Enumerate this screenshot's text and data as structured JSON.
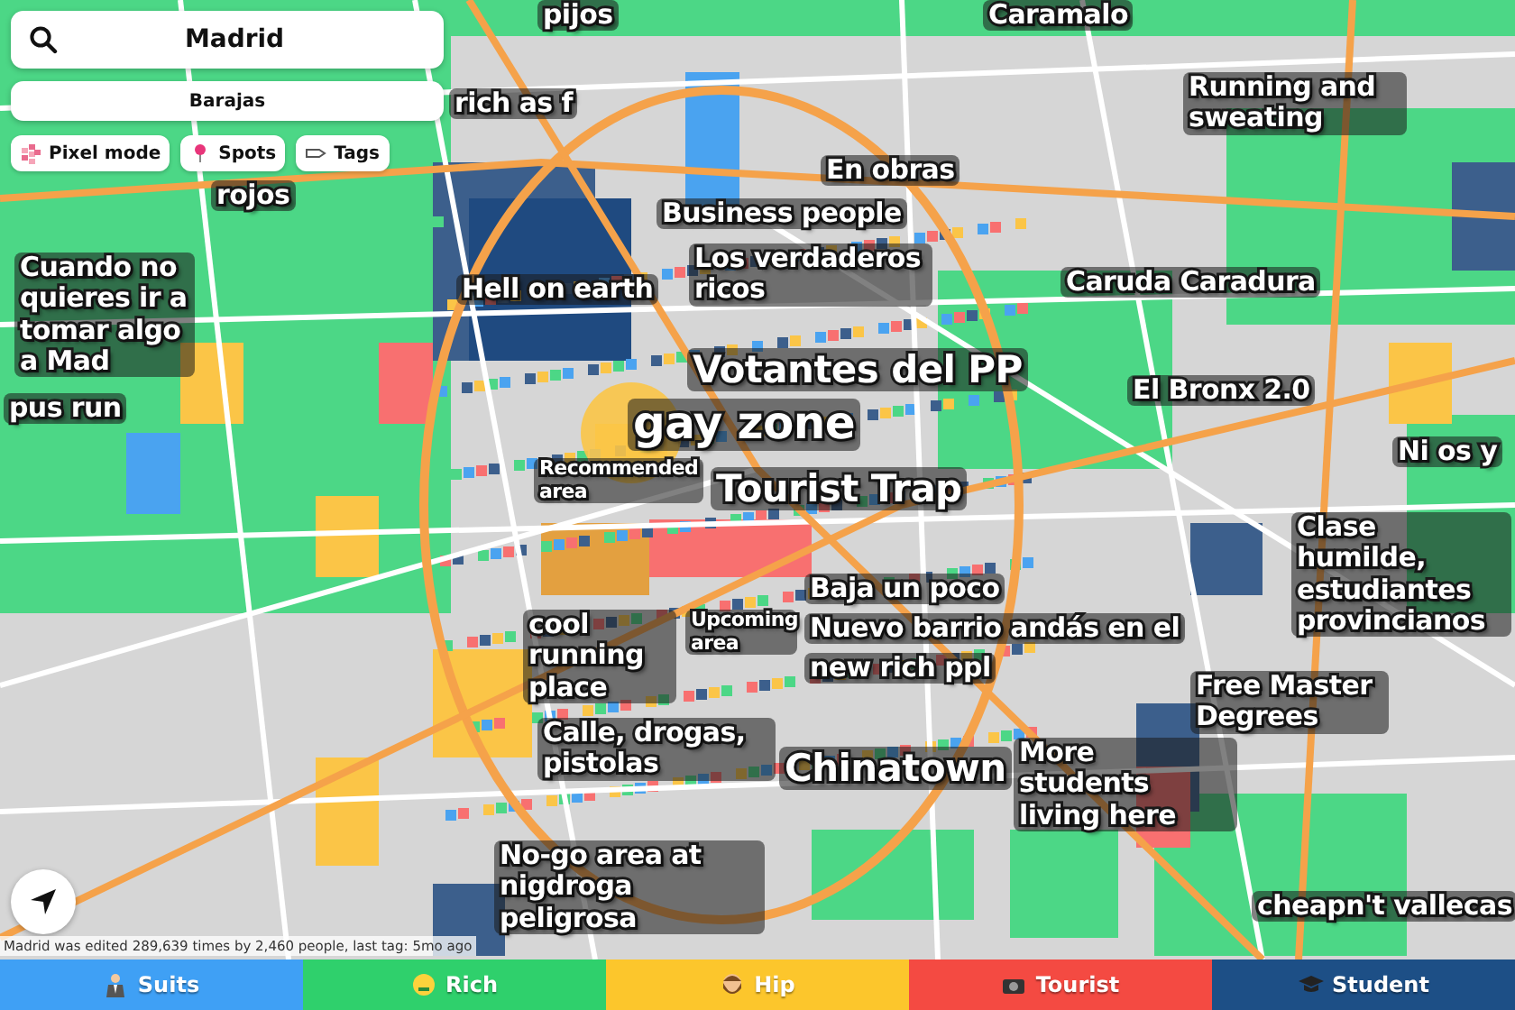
{
  "search": {
    "value": "Madrid"
  },
  "location": {
    "value": "Barajas"
  },
  "chips": [
    {
      "kind": "pixel",
      "label": "Pixel mode"
    },
    {
      "kind": "spots",
      "label": "Spots"
    },
    {
      "kind": "tags",
      "label": "Tags"
    }
  ],
  "map_tags": [
    {
      "text": "pijos"
    },
    {
      "text": "Caramalo"
    },
    {
      "text": "rich as f"
    },
    {
      "text": "Running and sweating"
    },
    {
      "text": "En obras"
    },
    {
      "text": "rojos"
    },
    {
      "text": "Business people"
    },
    {
      "text": "Cuando no quieres ir a tomar algo a Mad"
    },
    {
      "text": "Hell on earth"
    },
    {
      "text": "Los verdaderos ricos"
    },
    {
      "text": "Caruda Caradura"
    },
    {
      "text": "Votantes del PP"
    },
    {
      "text": "pus run"
    },
    {
      "text": "El Bronx 2.0"
    },
    {
      "text": "gay zone"
    },
    {
      "text": "Ni os y"
    },
    {
      "text": "Recommended area"
    },
    {
      "text": "Tourist Trap"
    },
    {
      "text": "Clase humilde, estudiantes provincianos"
    },
    {
      "text": "Baja un poco"
    },
    {
      "text": "cool running place"
    },
    {
      "text": "Upcoming area"
    },
    {
      "text": "Nuevo barrio andás en el"
    },
    {
      "text": "new rich ppl"
    },
    {
      "text": "Free Master Degrees"
    },
    {
      "text": "Calle, drogas, pistolas"
    },
    {
      "text": "Chinatown"
    },
    {
      "text": "More students living here"
    },
    {
      "text": "No-go area at nigdroga peligrosa"
    },
    {
      "text": "cheapn't vallecas"
    }
  ],
  "attribution": "Madrid was edited 289,639 times by 2,460 people, last tag: 5mo ago",
  "categories": [
    {
      "kind": "suits",
      "label": "Suits",
      "color": "#3fa0f5"
    },
    {
      "kind": "rich",
      "label": "Rich",
      "color": "#2fd06c"
    },
    {
      "kind": "hip",
      "label": "Hip",
      "color": "#fcc62c"
    },
    {
      "kind": "tourist",
      "label": "Tourist",
      "color": "#f44a42"
    },
    {
      "kind": "student",
      "label": "Student",
      "color": "#1d4f86"
    }
  ]
}
